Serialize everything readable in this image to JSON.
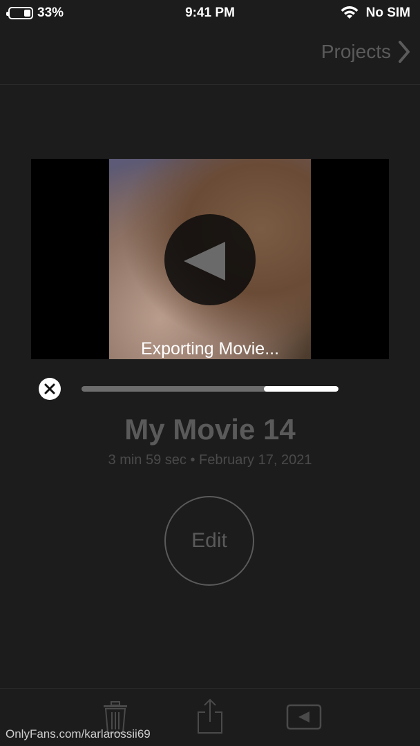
{
  "status_bar": {
    "battery": "33%",
    "time": "9:41 PM",
    "carrier": "No SIM",
    "battery_level": 0.33
  },
  "nav": {
    "back_label": "Projects"
  },
  "video": {
    "status_text": "Exporting Movie..."
  },
  "export": {
    "progress": 0.29
  },
  "project": {
    "title": "My Movie 14",
    "meta": "3 min 59 sec • February 17, 2021"
  },
  "actions": {
    "edit_label": "Edit"
  },
  "watermark": "OnlyFans.com/karlarossii69",
  "toolbar": {
    "icons": [
      "trash-icon",
      "share-icon",
      "play-icon"
    ]
  },
  "colors": {
    "background": "#1c1c1c",
    "dimmed_text": "#5a5a5a",
    "progress_fill": "#ffffff",
    "progress_track": "#6d6d6d"
  }
}
